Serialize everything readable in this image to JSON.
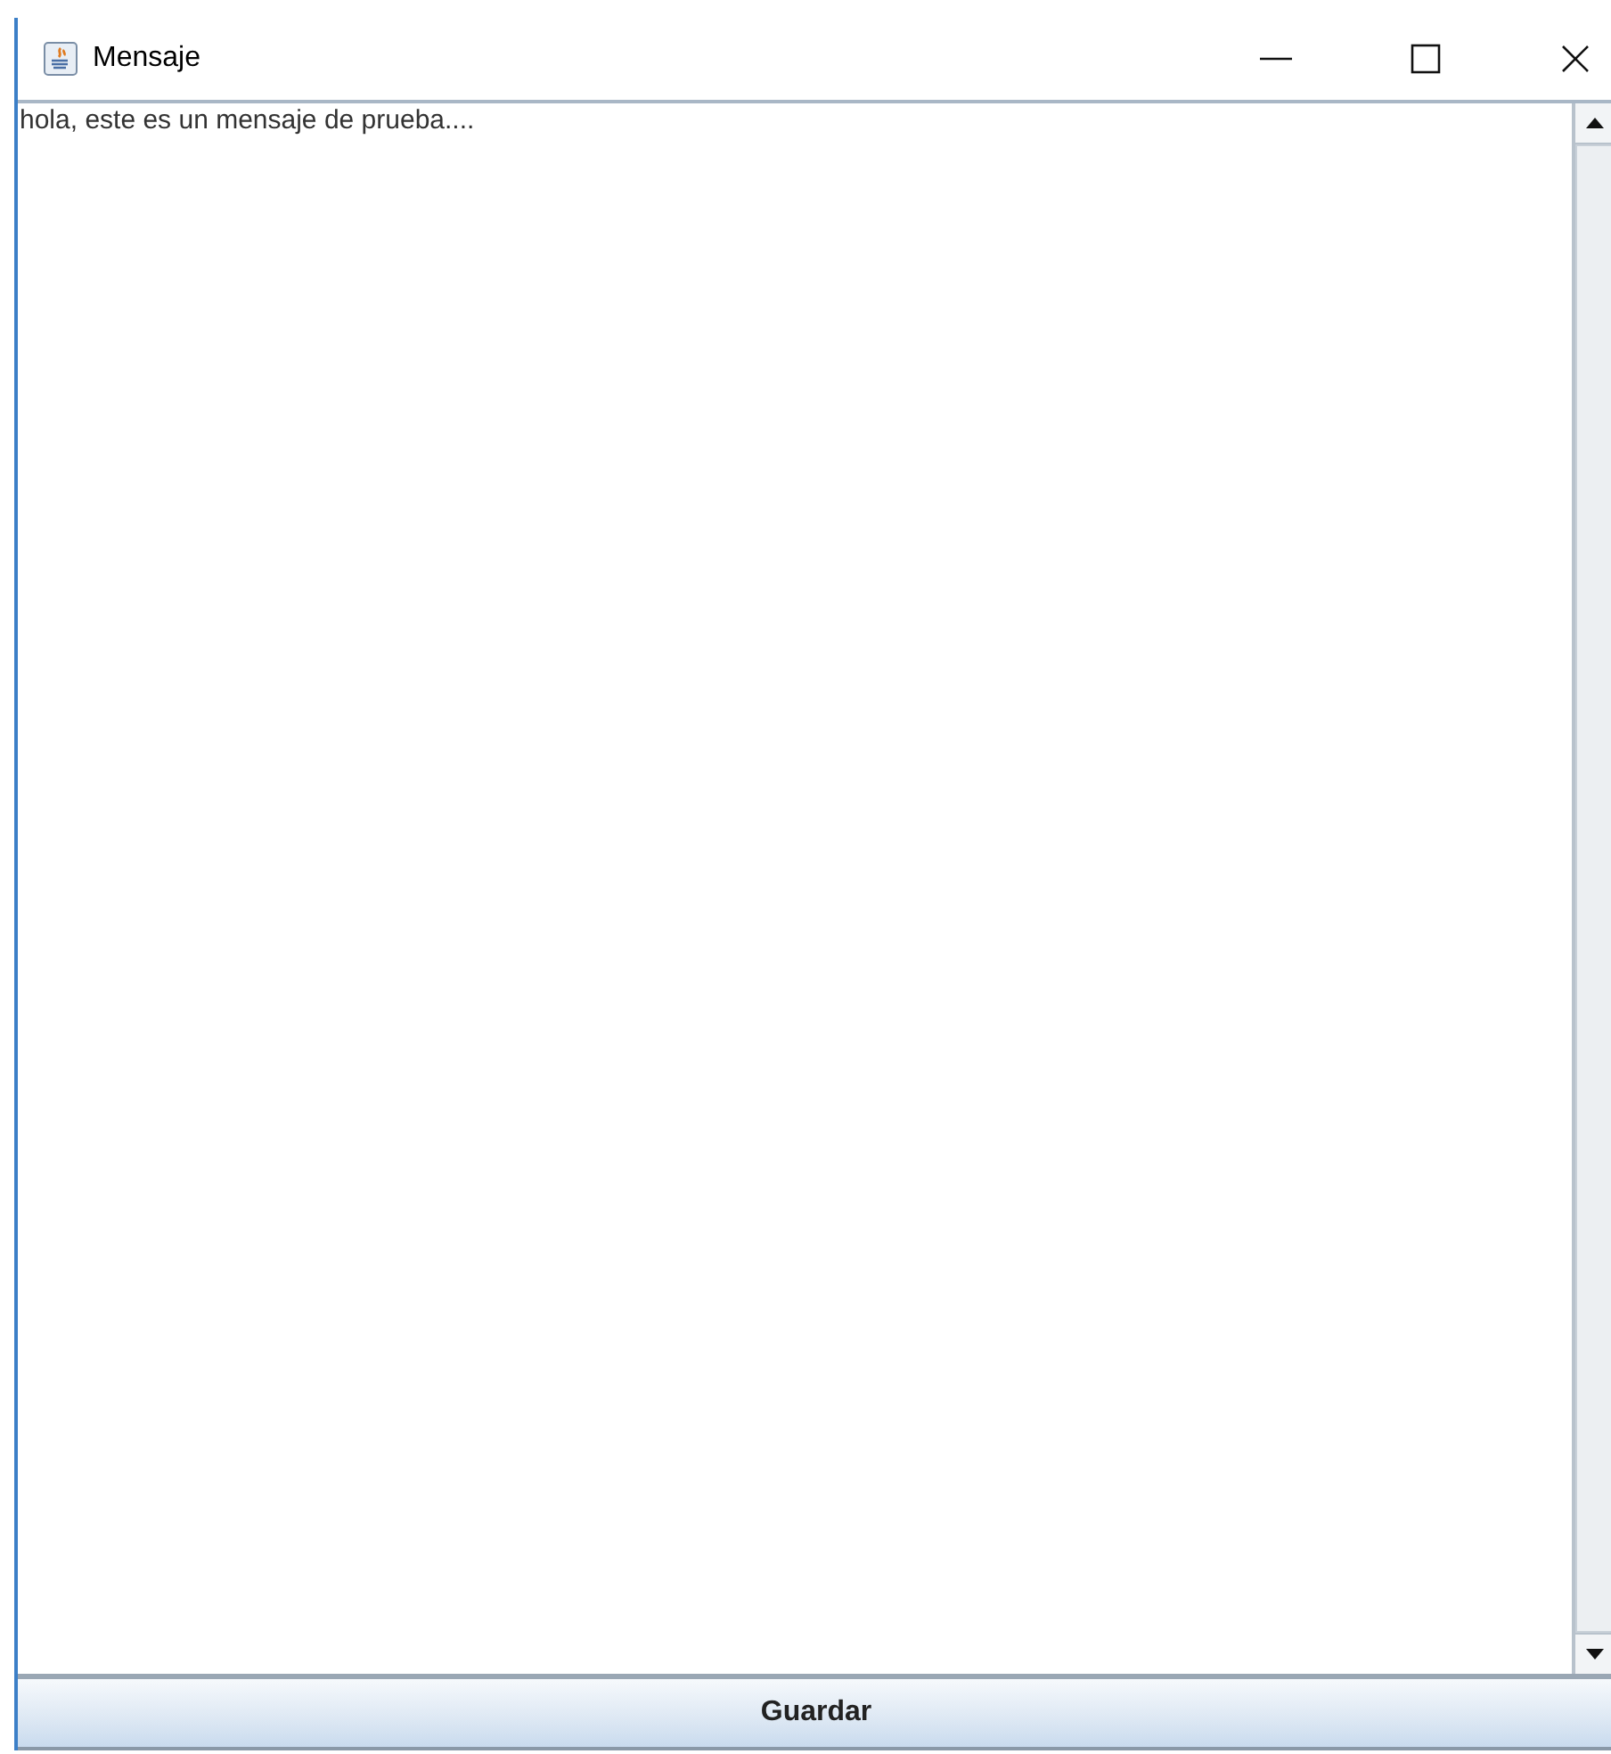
{
  "window": {
    "title": "Mensaje"
  },
  "text_area": {
    "value": "hola, este es un mensaje de prueba...."
  },
  "buttons": [
    {
      "label": "Guardar"
    }
  ]
}
